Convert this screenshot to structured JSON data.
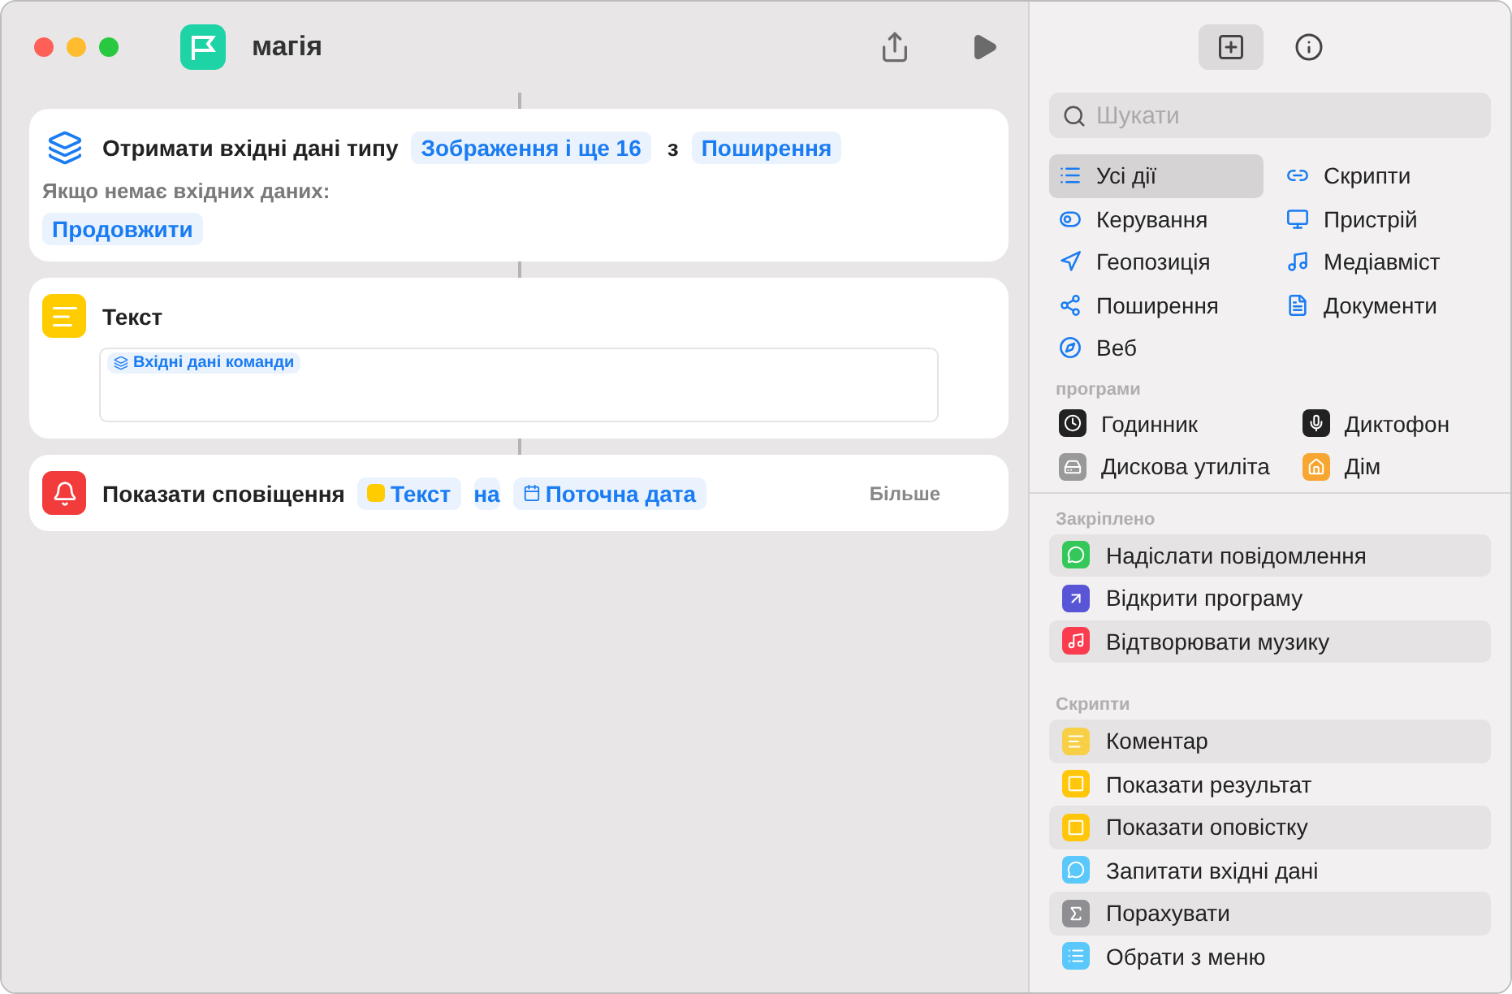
{
  "window": {
    "title": "магія"
  },
  "actions": [
    {
      "kind": "input",
      "title": "Отримати вхідні дані типу",
      "type_token": "Зображення і ще 16",
      "joiner": "з",
      "source_token": "Поширення",
      "fallback_label": "Якщо немає вхідних даних:",
      "fallback_token": "Продовжити"
    },
    {
      "kind": "text",
      "title": "Текст",
      "variable": "Вхідні дані команди"
    },
    {
      "kind": "notify",
      "title": "Показати сповіщення",
      "text_token": "Текст",
      "joiner": "на",
      "date_token": "Поточна дата",
      "more": "Більше"
    }
  ],
  "search": {
    "placeholder": "Шукати"
  },
  "categories": [
    {
      "label": "Усі дії",
      "selected": true
    },
    {
      "label": "Скрипти",
      "selected": false
    },
    {
      "label": "Керування",
      "selected": false
    },
    {
      "label": "Пристрій",
      "selected": false
    },
    {
      "label": "Геопозиція",
      "selected": false
    },
    {
      "label": "Медіавміст",
      "selected": false
    },
    {
      "label": "Поширення",
      "selected": false
    },
    {
      "label": "Документи",
      "selected": false
    },
    {
      "label": "Веб",
      "selected": false
    }
  ],
  "apps_heading": "програми",
  "apps": [
    "Годинник",
    "Диктофон",
    "Дискова утиліта",
    "Дім"
  ],
  "pinned": {
    "heading": "Закріплено",
    "items": [
      {
        "label": "Надіслати повідомлення",
        "color": "#34c759"
      },
      {
        "label": "Відкрити програму",
        "color": "#5856d6"
      },
      {
        "label": "Відтворювати музику",
        "color": "#fa3c4e"
      }
    ]
  },
  "scripts": {
    "heading": "Скрипти",
    "items": [
      {
        "label": "Коментар",
        "color": "#f7d046"
      },
      {
        "label": "Показати результат",
        "color": "#ffc60a"
      },
      {
        "label": "Показати оповістку",
        "color": "#ffc60a"
      },
      {
        "label": "Запитати вхідні дані",
        "color": "#5ac8fa"
      },
      {
        "label": "Порахувати",
        "color": "#8e8e93"
      },
      {
        "label": "Обрати з меню",
        "color": "#5ac8fa"
      }
    ]
  }
}
